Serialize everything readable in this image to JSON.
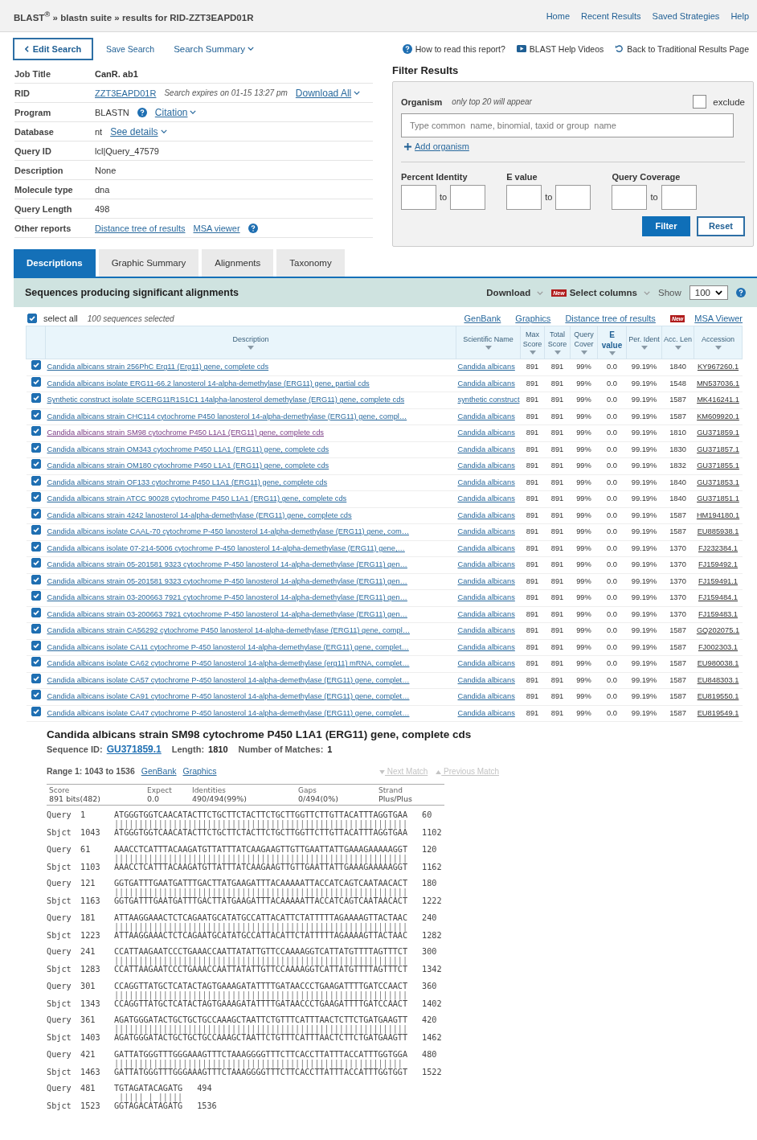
{
  "header": {
    "breadcrumb": "BLAST$^{®}$ » blastn suite » results for RID-ZZT3EAPD01R",
    "nav": [
      "Home",
      "Recent Results",
      "Saved Strategies",
      "Help"
    ]
  },
  "toolbar": {
    "edit_search": "Edit Search",
    "save_search": "Save Search",
    "search_summary": "Search Summary",
    "help_links": [
      {
        "kind": "help",
        "text": "How to read this report?"
      },
      {
        "kind": "video",
        "text": "BLAST Help Videos"
      },
      {
        "kind": "back",
        "text": "Back to Traditional Results Page"
      }
    ]
  },
  "job": [
    {
      "label": "Job Title",
      "items": [
        {
          "kind": "bold",
          "text": "CanR. ab1"
        }
      ]
    },
    {
      "label": "RID",
      "items": [
        {
          "kind": "link",
          "text": "ZZT3EAPD01R"
        },
        {
          "kind": "note",
          "text": "Search expires on 01-15 13:27 pm"
        },
        {
          "kind": "menu",
          "text": "Download All"
        }
      ]
    },
    {
      "label": "Program",
      "items": [
        {
          "kind": "text",
          "text": "BLASTN"
        },
        {
          "kind": "help"
        },
        {
          "kind": "menu",
          "text": "Citation"
        }
      ]
    },
    {
      "label": "Database",
      "items": [
        {
          "kind": "text",
          "text": "nt"
        },
        {
          "kind": "menu",
          "text": "See details"
        }
      ]
    },
    {
      "label": "Query ID",
      "items": [
        {
          "kind": "text",
          "text": "lcl|Query_47579"
        }
      ]
    },
    {
      "label": "Description",
      "items": [
        {
          "kind": "text",
          "text": "None"
        }
      ]
    },
    {
      "label": "Molecule type",
      "items": [
        {
          "kind": "text",
          "text": "dna"
        }
      ]
    },
    {
      "label": "Query Length",
      "items": [
        {
          "kind": "text",
          "text": "498"
        }
      ]
    },
    {
      "label": "Other reports",
      "items": [
        {
          "kind": "link",
          "text": "Distance tree of results"
        },
        {
          "kind": "link",
          "text": "MSA viewer"
        },
        {
          "kind": "help"
        }
      ]
    }
  ],
  "filter": {
    "title": "Filter Results",
    "organism_label": "Organism",
    "organism_note": "only top 20 will appear",
    "exclude": {
      "label": "exclude",
      "checked": false
    },
    "organism_placeholder": "Type common  name, binomial, taxid or group  name",
    "add_organism": "Add organism",
    "ranges": [
      {
        "label": "Percent Identity",
        "to": "to"
      },
      {
        "label": "E value",
        "to": "to"
      },
      {
        "label": "Query Coverage",
        "to": "to"
      }
    ],
    "buttons": [
      {
        "kind": "primary",
        "text": "Filter"
      },
      {
        "kind": "secondary",
        "text": "Reset"
      }
    ]
  },
  "tabs": [
    {
      "label": "Descriptions",
      "selected": true
    },
    {
      "label": "Graphic Summary",
      "selected": false
    },
    {
      "label": "Alignments",
      "selected": false
    },
    {
      "label": "Taxonomy",
      "selected": false
    }
  ],
  "results": {
    "title": "Sequences producing significant alignments",
    "download": "Download",
    "new_badge": "New",
    "select_columns": "Select columns",
    "show_label": "Show",
    "show_value": "100",
    "select_all": {
      "label": "select all",
      "checked": true
    },
    "selected_count": "100 sequences selected",
    "links": [
      {
        "text": "GenBank"
      },
      {
        "text": "Graphics"
      },
      {
        "text": "Distance tree of results"
      },
      {
        "text": "MSA Viewer",
        "badge": "New"
      }
    ]
  },
  "table": {
    "columns": [
      {
        "label": "Description",
        "sorted": false
      },
      {
        "label": "Scientific Name",
        "sorted": false
      },
      {
        "label": "Max Score",
        "sorted": false
      },
      {
        "label": "Total Score",
        "sorted": false
      },
      {
        "label": "Query Cover",
        "sorted": false
      },
      {
        "label": "E value",
        "sorted": true
      },
      {
        "label": "Per. Ident",
        "sorted": false
      },
      {
        "label": "Acc. Len",
        "sorted": false
      },
      {
        "label": "Accession",
        "sorted": false
      }
    ],
    "rows": [
      {
        "checked": true,
        "visited": false,
        "cells": [
          "Candida albicans strain 256PhC Erg11 (Erg11) gene, complete cds",
          "Candida albicans",
          "891",
          "891",
          "99%",
          "0.0",
          "99.19%",
          "1840",
          "KY967260.1"
        ]
      },
      {
        "checked": true,
        "visited": false,
        "cells": [
          "Candida albicans isolate ERG11-66.2 lanosterol 14-alpha-demethylase (ERG11) gene, partial cds",
          "Candida albicans",
          "891",
          "891",
          "99%",
          "0.0",
          "99.19%",
          "1548",
          "MN537036.1"
        ]
      },
      {
        "checked": true,
        "visited": false,
        "cells": [
          "Synthetic construct isolate SCERG11R1S1C1 14alpha-lanosterol demethylase (ERG11) gene, complete cds",
          "synthetic construct",
          "891",
          "891",
          "99%",
          "0.0",
          "99.19%",
          "1587",
          "MK416241.1"
        ]
      },
      {
        "checked": true,
        "visited": false,
        "cells": [
          "Candida albicans strain CHC114 cytochrome P450 lanosterol 14-alpha-demethylase (ERG11) gene, compl…",
          "Candida albicans",
          "891",
          "891",
          "99%",
          "0.0",
          "99.19%",
          "1587",
          "KM609920.1"
        ]
      },
      {
        "checked": true,
        "visited": true,
        "cells": [
          "Candida albicans strain SM98 cytochrome P450 L1A1 (ERG11) gene, complete cds",
          "Candida albicans",
          "891",
          "891",
          "99%",
          "0.0",
          "99.19%",
          "1810",
          "GU371859.1"
        ]
      },
      {
        "checked": true,
        "visited": false,
        "cells": [
          "Candida albicans strain OM343 cytochrome P450 L1A1 (ERG11) gene, complete cds",
          "Candida albicans",
          "891",
          "891",
          "99%",
          "0.0",
          "99.19%",
          "1830",
          "GU371857.1"
        ]
      },
      {
        "checked": true,
        "visited": false,
        "cells": [
          "Candida albicans strain OM180 cytochrome P450 L1A1 (ERG11) gene, complete cds",
          "Candida albicans",
          "891",
          "891",
          "99%",
          "0.0",
          "99.19%",
          "1832",
          "GU371855.1"
        ]
      },
      {
        "checked": true,
        "visited": false,
        "cells": [
          "Candida albicans strain OF133 cytochrome P450 L1A1 (ERG11) gene, complete cds",
          "Candida albicans",
          "891",
          "891",
          "99%",
          "0.0",
          "99.19%",
          "1840",
          "GU371853.1"
        ]
      },
      {
        "checked": true,
        "visited": false,
        "cells": [
          "Candida albicans strain ATCC 90028 cytochrome P450 L1A1 (ERG11) gene, complete cds",
          "Candida albicans",
          "891",
          "891",
          "99%",
          "0.0",
          "99.19%",
          "1840",
          "GU371851.1"
        ]
      },
      {
        "checked": true,
        "visited": false,
        "cells": [
          "Candida albicans strain 4242 lanosterol 14-alpha-demethylase (ERG11) gene, complete cds",
          "Candida albicans",
          "891",
          "891",
          "99%",
          "0.0",
          "99.19%",
          "1587",
          "HM194180.1"
        ]
      },
      {
        "checked": true,
        "visited": false,
        "cells": [
          "Candida albicans isolate CAAL-70 cytochrome P-450 lanosterol 14-alpha-demethylase (ERG11) gene, com…",
          "Candida albicans",
          "891",
          "891",
          "99%",
          "0.0",
          "99.19%",
          "1587",
          "EU885938.1"
        ]
      },
      {
        "checked": true,
        "visited": false,
        "cells": [
          "Candida albicans isolate 07-214-5006 cytochrome P-450 lanosterol 14-alpha-demethylase (ERG11) gene,…",
          "Candida albicans",
          "891",
          "891",
          "99%",
          "0.0",
          "99.19%",
          "1370",
          "FJ232384.1"
        ]
      },
      {
        "checked": true,
        "visited": false,
        "cells": [
          "Candida albicans strain 05-201581 9323 cytochrome P-450 lanosterol 14-alpha-demethylase (ERG11) gen…",
          "Candida albicans",
          "891",
          "891",
          "99%",
          "0.0",
          "99.19%",
          "1370",
          "FJ159492.1"
        ]
      },
      {
        "checked": true,
        "visited": false,
        "cells": [
          "Candida albicans strain 05-201581 9323 cytochrome P-450 lanosterol 14-alpha-demethylase (ERG11) gen…",
          "Candida albicans",
          "891",
          "891",
          "99%",
          "0.0",
          "99.19%",
          "1370",
          "FJ159491.1"
        ]
      },
      {
        "checked": true,
        "visited": false,
        "cells": [
          "Candida albicans strain 03-200663 7921 cytochrome P-450 lanosterol 14-alpha-demethylase (ERG11) gen…",
          "Candida albicans",
          "891",
          "891",
          "99%",
          "0.0",
          "99.19%",
          "1370",
          "FJ159484.1"
        ]
      },
      {
        "checked": true,
        "visited": false,
        "cells": [
          "Candida albicans strain 03-200663 7921 cytochrome P-450 lanosterol 14-alpha-demethylase (ERG11) gen…",
          "Candida albicans",
          "891",
          "891",
          "99%",
          "0.0",
          "99.19%",
          "1370",
          "FJ159483.1"
        ]
      },
      {
        "checked": true,
        "visited": false,
        "cells": [
          "Candida albicans strain CA56292 cytochrome P450 lanosterol 14-alpha-demethylase (ERG11) gene, compl…",
          "Candida albicans",
          "891",
          "891",
          "99%",
          "0.0",
          "99.19%",
          "1587",
          "GQ202075.1"
        ]
      },
      {
        "checked": true,
        "visited": false,
        "cells": [
          "Candida albicans isolate CA11 cytochrome P-450 lanosterol 14-alpha-demethylase (ERG11) gene, complet…",
          "Candida albicans",
          "891",
          "891",
          "99%",
          "0.0",
          "99.19%",
          "1587",
          "FJ002303.1"
        ]
      },
      {
        "checked": true,
        "visited": false,
        "cells": [
          "Candida albicans isolate CA62 cytochrome P-450 lanosterol 14-alpha-demethylase (erg11) mRNA, complet…",
          "Candida albicans",
          "891",
          "891",
          "99%",
          "0.0",
          "99.19%",
          "1587",
          "EU980038.1"
        ]
      },
      {
        "checked": true,
        "visited": false,
        "cells": [
          "Candida albicans isolate CA57 cytochrome P-450 lanosterol 14-alpha-demethylase (ERG11) gene, complet…",
          "Candida albicans",
          "891",
          "891",
          "99%",
          "0.0",
          "99.19%",
          "1587",
          "EU848303.1"
        ]
      },
      {
        "checked": true,
        "visited": false,
        "cells": [
          "Candida albicans isolate CA91 cytochrome P-450 lanosterol 14-alpha-demethylase (ERG11) gene, complet…",
          "Candida albicans",
          "891",
          "891",
          "99%",
          "0.0",
          "99.19%",
          "1587",
          "EU819550.1"
        ]
      },
      {
        "checked": true,
        "visited": false,
        "cells": [
          "Candida albicans isolate CA47 cytochrome P-450 lanosterol 14-alpha-demethylase (ERG11) gene, complet…",
          "Candida albicans",
          "891",
          "891",
          "99%",
          "0.0",
          "99.19%",
          "1587",
          "EU819549.1"
        ]
      }
    ]
  },
  "alignment": {
    "title": "Candida albicans strain SM98 cytochrome P450 L1A1 (ERG11) gene, complete cds",
    "seq_id_label": "Sequence ID:",
    "seq_id": "GU371859.1",
    "length_label": "Length:",
    "length": "1810",
    "matches_label": "Number of Matches:",
    "matches": "1",
    "range": "Range 1: 1043 to 1536",
    "range_links": [
      "GenBank",
      "Graphics"
    ],
    "next_match": {
      "text": "Next Match",
      "disabled": true
    },
    "previous_match": {
      "text": "Previous Match",
      "disabled": true
    },
    "stats": [
      {
        "label": "Score",
        "value": "891 bits(482)"
      },
      {
        "label": "Expect",
        "value": "0.0"
      },
      {
        "label": "Identities",
        "value": "490/494(99%)"
      },
      {
        "label": "Gaps",
        "value": "0/494(0%)"
      },
      {
        "label": "Strand",
        "value": "Plus/Plus"
      }
    ],
    "blocks": [
      {
        "query_label": "Query",
        "sbjct_label": "Sbjct",
        "q_start": "1",
        "query": "ATGGGTGGTCAACATACTTCTGCTTCTACTTCTGCTTGGTTCTTGTTACATTTAGGTGAA",
        "q_end": "60",
        "match": "||||||||||||||||||||||||||||||||||||||||||||||||||||||||||||",
        "s_start": "1043",
        "sbjct": "ATGGGTGGTCAACATACTTCTGCTTCTACTTCTGCTTGGTTCTTGTTACATTTAGGTGAA",
        "s_end": "1102"
      },
      {
        "query_label": "Query",
        "sbjct_label": "Sbjct",
        "q_start": "61",
        "query": "AAACCTCATTTACAAGATGTTATTTATCAAGAAGTTGTTGAATTATTGAAAGAAAAAGGT",
        "q_end": "120",
        "match": "||||||||||||||||||||||||||||||||||||||||||||||||||||||||||||",
        "s_start": "1103",
        "sbjct": "AAACCTCATTTACAAGATGTTATTTATCAAGAAGTTGTTGAATTATTGAAAGAAAAAGGT",
        "s_end": "1162"
      },
      {
        "query_label": "Query",
        "sbjct_label": "Sbjct",
        "q_start": "121",
        "query": "GGTGATTTGAATGATTTGACTTATGAAGATTTACAAAAATTACCATCAGTCAATAACACT",
        "q_end": "180",
        "match": "||||||||||||||||||||||||||||||||||||||||||||||||||||||||||||",
        "s_start": "1163",
        "sbjct": "GGTGATTTGAATGATTTGACTTATGAAGATTTACAAAAATTACCATCAGTCAATAACACT",
        "s_end": "1222"
      },
      {
        "query_label": "Query",
        "sbjct_label": "Sbjct",
        "q_start": "181",
        "query": "ATTAAGGAAACTCTCAGAATGCATATGCCATTACATTCTATTTTTAGAAAAGTTACTAAC",
        "q_end": "240",
        "match": "||||||||||||||||||||||||||||||||||||||||||||||||||||||||||||",
        "s_start": "1223",
        "sbjct": "ATTAAGGAAACTCTCAGAATGCATATGCCATTACATTCTATTTTTAGAAAAGTTACTAAC",
        "s_end": "1282"
      },
      {
        "query_label": "Query",
        "sbjct_label": "Sbjct",
        "q_start": "241",
        "query": "CCATTAAGAATCCCTGAAACCAATTATATTGTTCCAAAAGGTCATTATGTTTTAGTTTCT",
        "q_end": "300",
        "match": "||||||||||||||||||||||||||||||||||||||||||||||||||||||||||||",
        "s_start": "1283",
        "sbjct": "CCATTAAGAATCCCTGAAACCAATTATATTGTTCCAAAAGGTCATTATGTTTTAGTTTCT",
        "s_end": "1342"
      },
      {
        "query_label": "Query",
        "sbjct_label": "Sbjct",
        "q_start": "301",
        "query": "CCAGGTTATGCTCATACTAGTGAAAGATATTTTGATAACCCTGAAGATTTTGATCCAACT",
        "q_end": "360",
        "match": "||||||||||||||||||||||||||||||||||||||||||||||||||||||||||||",
        "s_start": "1343",
        "sbjct": "CCAGGTTATGCTCATACTAGTGAAAGATATTTTGATAACCCTGAAGATTTTGATCCAACT",
        "s_end": "1402"
      },
      {
        "query_label": "Query",
        "sbjct_label": "Sbjct",
        "q_start": "361",
        "query": "AGATGGGATACTGCTGCTGCCAAAGCTAATTCTGTTTCATTTAACTCTTCTGATGAAGTT",
        "q_end": "420",
        "match": "||||||||||||||||||||||||||||||||||||||||||||||||||||||||||||",
        "s_start": "1403",
        "sbjct": "AGATGGGATACTGCTGCTGCCAAAGCTAATTCTGTTTCATTTAACTCTTCTGATGAAGTT",
        "s_end": "1462"
      },
      {
        "query_label": "Query",
        "sbjct_label": "Sbjct",
        "q_start": "421",
        "query": "GATTATGGGTTTGGGAAAGTTTCTAAAGGGGTTTCTTCACCTTATTTACCATTTGGTGGA",
        "q_end": "480",
        "match": "|||||||||||||||||||||||||||||||||||||||||||||||||||||||||||",
        "s_start": "1463",
        "sbjct": "GATTATGGGTTTGGGAAAGTTTCTAAAGGGGTTTCTTCACCTTATTTACCATTTGGTGGT",
        "s_end": "1522"
      },
      {
        "query_label": "Query",
        "sbjct_label": "Sbjct",
        "q_start": "481",
        "query": "TGTAGATACAGATG",
        "q_end": "494",
        "match": " ||||| | |||||",
        "s_start": "1523",
        "sbjct": "GGTAGACATAGATG",
        "s_end": "1536"
      }
    ]
  }
}
